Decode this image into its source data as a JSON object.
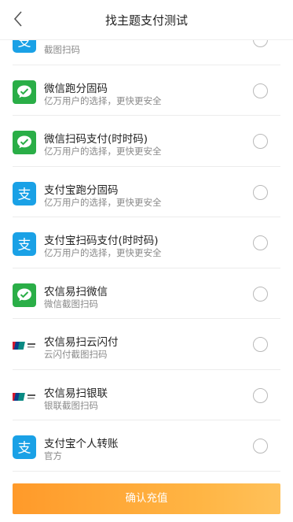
{
  "header": {
    "title": "找主题支付测试",
    "back_icon": "chevron-left-icon"
  },
  "colors": {
    "wechat": "#2aae47",
    "alipay": "#1aa1e6",
    "button": "#ffa733"
  },
  "items": [
    {
      "icon": "alipay-icon",
      "name": "",
      "desc": "截图扫码"
    },
    {
      "icon": "wechat-icon",
      "name": "微信跑分固码",
      "desc": "亿万用户的选择，更快更安全"
    },
    {
      "icon": "wechat-icon",
      "name": "微信扫码支付(时时码)",
      "desc": "亿万用户的选择，更快更安全"
    },
    {
      "icon": "alipay-icon",
      "name": "支付宝跑分固码",
      "desc": "亿万用户的选择，更快更安全"
    },
    {
      "icon": "alipay-icon",
      "name": "支付宝扫码支付(时时码)",
      "desc": "亿万用户的选择，更快更安全"
    },
    {
      "icon": "wechat-icon",
      "name": "农信易扫微信",
      "desc": "微信截图扫码"
    },
    {
      "icon": "unionpay-icon",
      "name": "农信易扫云闪付",
      "desc": "云闪付截图扫码"
    },
    {
      "icon": "unionpay-icon",
      "name": "农信易扫银联",
      "desc": "银联截图扫码"
    },
    {
      "icon": "alipay-icon",
      "name": "支付宝个人转账",
      "desc": "官方"
    }
  ],
  "confirm_button": {
    "label": "确认充值"
  }
}
